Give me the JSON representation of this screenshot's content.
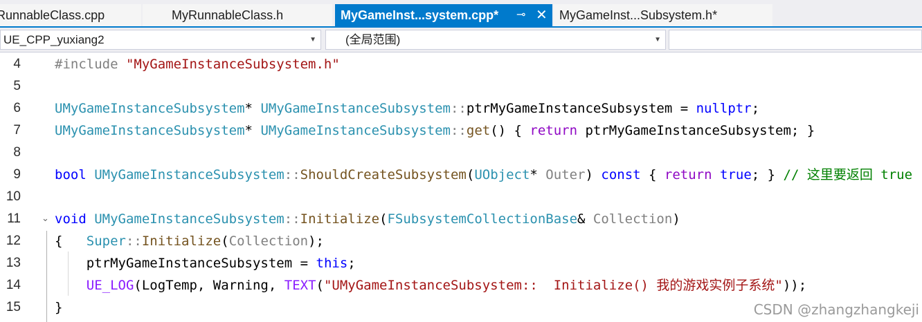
{
  "tabs": [
    {
      "label": "yRunnableClass.cpp",
      "active": false
    },
    {
      "label": "MyRunnableClass.h",
      "active": false
    },
    {
      "label": "MyGameInst...system.cpp*",
      "active": true,
      "pin_glyph": "⊸",
      "close_glyph": "✕"
    },
    {
      "label": "MyGameInst...Subsystem.h*",
      "active": false
    }
  ],
  "navbar": {
    "project": "UE_CPP_yuxiang2",
    "scope": "(全局范围)",
    "member": ""
  },
  "colors": {
    "accent": "#007acc",
    "keyword": "#0000ff",
    "control_keyword": "#8f08c4",
    "type": "#2b91af",
    "function": "#74531f",
    "string": "#a31515",
    "comment": "#008000"
  },
  "editor": {
    "lines": [
      {
        "number": "4",
        "tokens": [
          [
            "pp",
            "#include "
          ],
          [
            "st",
            "\"MyGameInstanceSubsystem.h\""
          ]
        ]
      },
      {
        "number": "5",
        "tokens": []
      },
      {
        "number": "6",
        "tokens": [
          [
            "ty",
            "UMyGameInstanceSubsystem"
          ],
          [
            "tx",
            "* "
          ],
          [
            "ty",
            "UMyGameInstanceSubsystem"
          ],
          [
            "pa",
            "::"
          ],
          [
            "tx",
            "ptrMyGameInstanceSubsystem = "
          ],
          [
            "k",
            "nullptr"
          ],
          [
            "tx",
            ";"
          ]
        ]
      },
      {
        "number": "7",
        "tokens": [
          [
            "ty",
            "UMyGameInstanceSubsystem"
          ],
          [
            "tx",
            "* "
          ],
          [
            "ty",
            "UMyGameInstanceSubsystem"
          ],
          [
            "pa",
            "::"
          ],
          [
            "fn",
            "get"
          ],
          [
            "tx",
            "() { "
          ],
          [
            "kp",
            "return"
          ],
          [
            "tx",
            " ptrMyGameInstanceSubsystem; }"
          ]
        ]
      },
      {
        "number": "8",
        "tokens": []
      },
      {
        "number": "9",
        "tokens": [
          [
            "k",
            "bool "
          ],
          [
            "ty",
            "UMyGameInstanceSubsystem"
          ],
          [
            "pa",
            "::"
          ],
          [
            "fn",
            "ShouldCreateSubsystem"
          ],
          [
            "tx",
            "("
          ],
          [
            "ty",
            "UObject"
          ],
          [
            "tx",
            "* "
          ],
          [
            "pa",
            "Outer"
          ],
          [
            "tx",
            ") "
          ],
          [
            "k",
            "const"
          ],
          [
            "tx",
            " { "
          ],
          [
            "kp",
            "return"
          ],
          [
            "tx",
            " "
          ],
          [
            "k",
            "true"
          ],
          [
            "tx",
            "; } "
          ],
          [
            "cm",
            "// 这里要返回 true"
          ]
        ]
      },
      {
        "number": "10",
        "tokens": []
      },
      {
        "number": "11",
        "fold": "⌄",
        "tokens": [
          [
            "k",
            "void "
          ],
          [
            "ty",
            "UMyGameInstanceSubsystem"
          ],
          [
            "pa",
            "::"
          ],
          [
            "fn",
            "Initialize"
          ],
          [
            "tx",
            "("
          ],
          [
            "ty",
            "FSubsystemCollectionBase"
          ],
          [
            "tx",
            "& "
          ],
          [
            "pa",
            "Collection"
          ],
          [
            "tx",
            ")"
          ]
        ]
      },
      {
        "number": "12",
        "tokens": [
          [
            "tx",
            "{   "
          ],
          [
            "ty",
            "Super"
          ],
          [
            "pa",
            "::"
          ],
          [
            "fn",
            "Initialize"
          ],
          [
            "tx",
            "("
          ],
          [
            "pa",
            "Collection"
          ],
          [
            "tx",
            ");"
          ]
        ]
      },
      {
        "number": "13",
        "tokens": [
          [
            "tx",
            "    ptrMyGameInstanceSubsystem = "
          ],
          [
            "k",
            "this"
          ],
          [
            "tx",
            ";"
          ]
        ]
      },
      {
        "number": "14",
        "tokens": [
          [
            "tx",
            "    "
          ],
          [
            "mc",
            "UE_LOG"
          ],
          [
            "tx",
            "(LogTemp, Warning, "
          ],
          [
            "mc",
            "TEXT"
          ],
          [
            "tx",
            "("
          ],
          [
            "st",
            "\"UMyGameInstanceSubsystem::  Initialize() 我的游戏实例子系统\""
          ],
          [
            "tx",
            "));"
          ]
        ]
      },
      {
        "number": "15",
        "tokens": [
          [
            "tx",
            "}"
          ]
        ]
      }
    ]
  },
  "watermark": "CSDN @zhangzhangkeji"
}
